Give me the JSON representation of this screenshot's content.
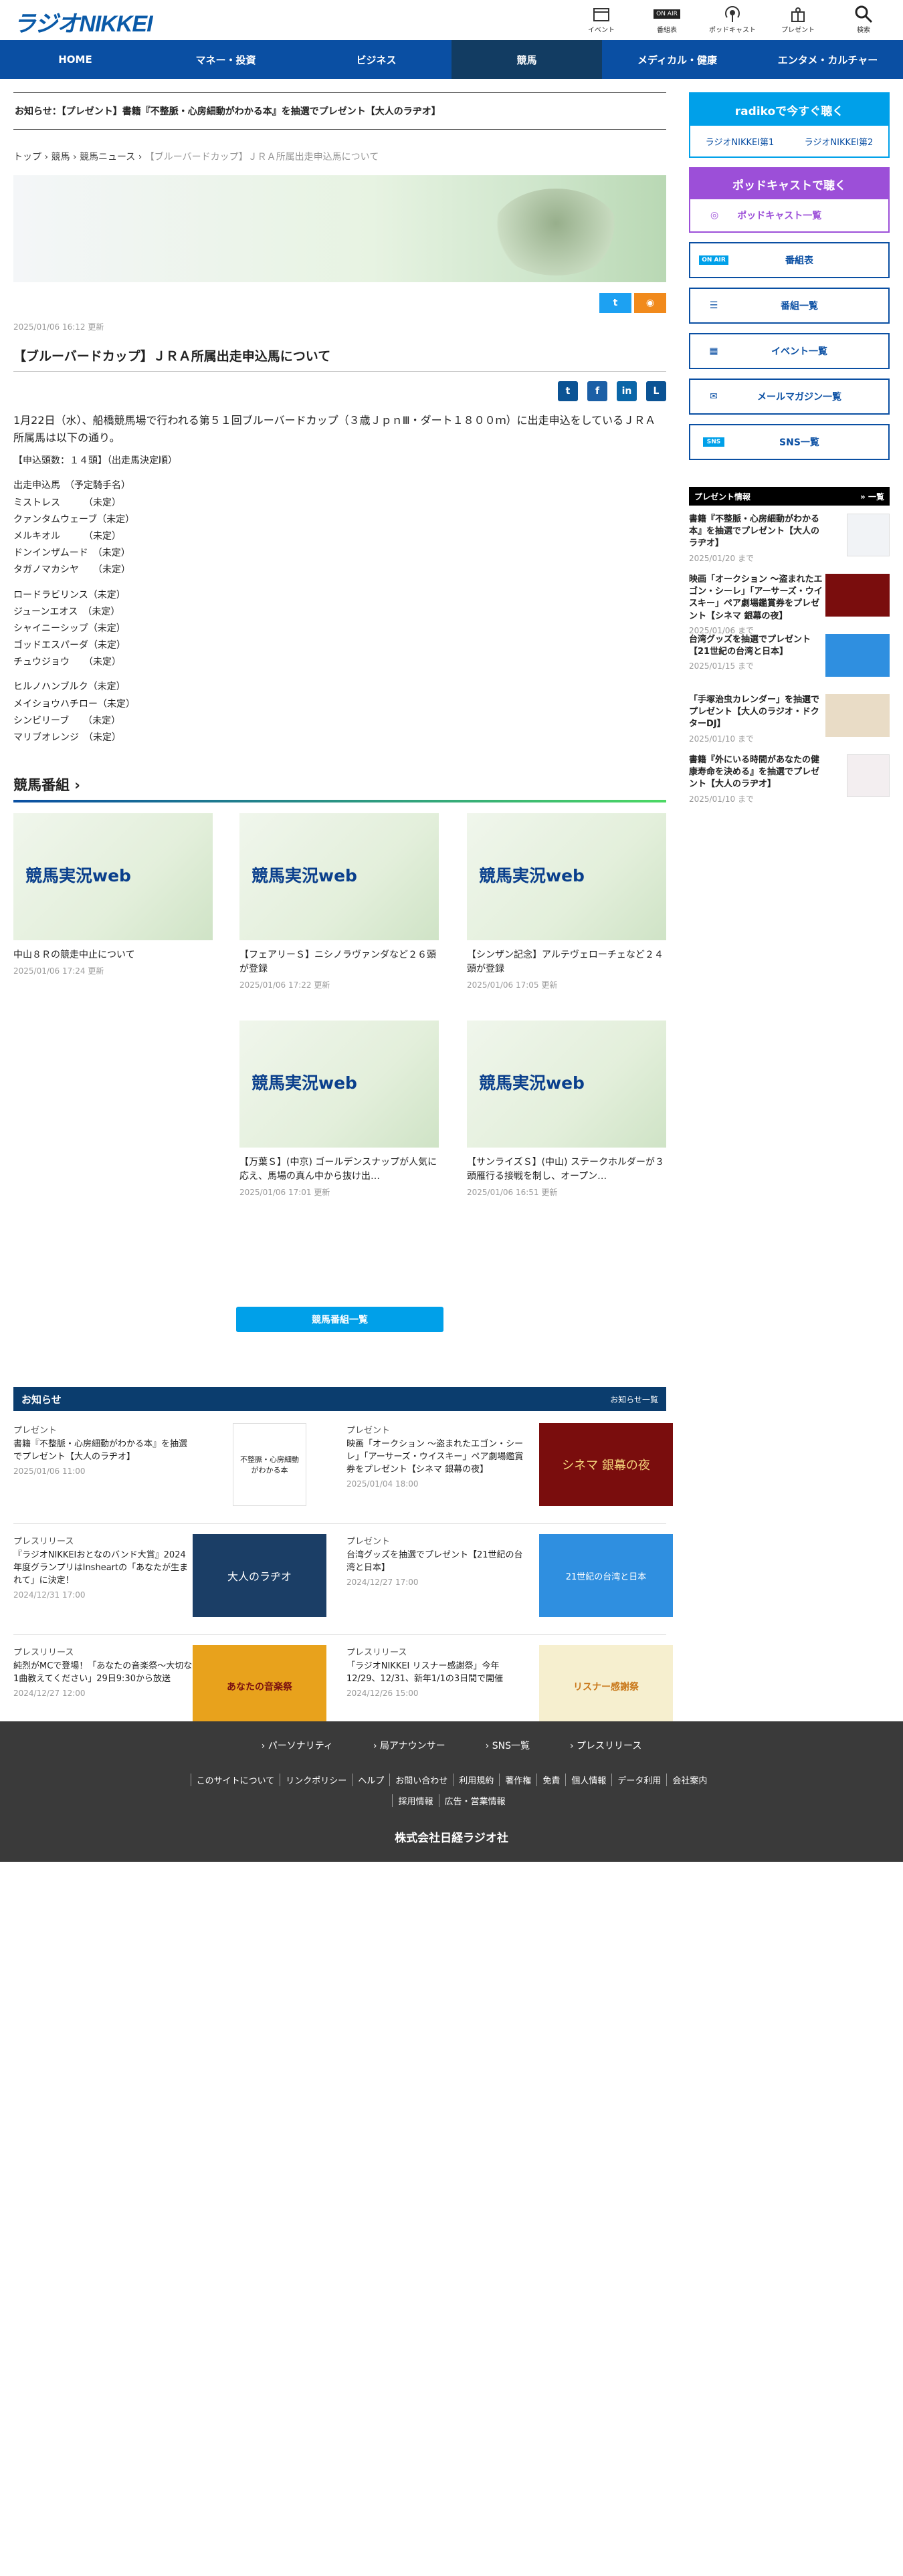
{
  "header": {
    "logo": "ラジオNIKKEI",
    "icons": [
      {
        "name": "calendar-icon",
        "label": "イベント"
      },
      {
        "name": "onair-icon",
        "label": "番組表",
        "badge": "ON AIR"
      },
      {
        "name": "podcast-icon",
        "label": "ポッドキャスト"
      },
      {
        "name": "present-icon",
        "label": "プレゼント"
      },
      {
        "name": "search-icon",
        "label": "検索"
      }
    ]
  },
  "nav": [
    "HOME",
    "マネー・投資",
    "ビジネス",
    "競馬",
    "メディカル・健康",
    "エンタメ・カルチャー"
  ],
  "notice": "お知らせ：【プレゼント】書籍『不整脈・心房細動がわかる本』を抽選でプレゼント【大人のラヂオ】",
  "breadcrumb": {
    "items": [
      "トップ",
      "競馬",
      "競馬ニュース"
    ],
    "current": "【ブルーバードカップ】ＪＲＡ所属出走申込馬について"
  },
  "article": {
    "date": "2025/01/06 16:12 更新",
    "title": "【ブルーバードカップ】ＪＲＡ所属出走申込馬について",
    "lead": "1月22日（水）、船橋競馬場で行われる第５１回ブルーバードカップ（３歳ＪｐｎⅢ・ダート１８００ｍ）に出走申込をしているＪＲＡ所属馬は以下の通り。",
    "count": "【申込頭数：１４頭】（出走馬決定順）",
    "horses1": "出走申込馬　（予定騎手名）\nミストレス　　　（未定）\nクァンタムウェーブ（未定）\nメルキオル　　　（未定）\nドンインザムード　（未定）\nタガノマカシヤ　　（未定）",
    "horses2": "ロードラビリンス（未定）\nジューンエオス　（未定）\nシャイニーシップ（未定）\nゴッドエスパーダ（未定）\nチュウジョウ　　（未定）",
    "horses3": "ヒルノハンブルク（未定）\nメイショウハチロー（未定）\nシンビリーブ　　（未定）\nマリブオレンジ　（未定）"
  },
  "programs": {
    "title": "競馬番組",
    "thumb_text": "競馬実況web",
    "items": [
      {
        "title": "中山８Ｒの競走中止について",
        "date": "2025/01/06 17:24 更新"
      },
      {
        "title": "【フェアリーＳ】ニシノラヴァンダなど２６頭が登録",
        "date": "2025/01/06 17:22 更新"
      },
      {
        "title": "【シンザン記念】アルテヴェローチェなど２４頭が登録",
        "date": "2025/01/06 17:05 更新"
      },
      {
        "title": "【万葉Ｓ】(中京) ゴールデンスナップが人気に応え、馬場の真ん中から抜け出…",
        "date": "2025/01/06 17:01 更新"
      },
      {
        "title": "【サンライズＳ】(中山) ステークホルダーが３頭雁行る接戦を制し、オープン…",
        "date": "2025/01/06 16:51 更新"
      }
    ],
    "button": "競馬番組一覧"
  },
  "news": {
    "title": "お知らせ",
    "more": "お知らせ一覧",
    "items": [
      {
        "cat": "プレゼント",
        "title": "書籍『不整脈・心房細動がわかる本』を抽選でプレゼント【大人のラヂオ】",
        "date": "2025/01/06 11:00",
        "img": "不整脈・心房細動がわかる本"
      },
      {
        "cat": "プレゼント",
        "title": "映画「オークション ～盗まれたエゴン・シーレ」「アーサーズ・ウイスキー」ペア劇場鑑賞券をプレゼント【シネマ 銀幕の夜】",
        "date": "2025/01/04 18:00",
        "img": "シネマ 銀幕の夜"
      },
      {
        "cat": "プレスリリース",
        "title": "『ラジオNIKKEIおとなのバンド大賞』2024年度グランプリはInsheartの「あなたが生まれて」に決定！",
        "date": "2024/12/31 17:00",
        "img": "大人のラヂオ"
      },
      {
        "cat": "プレゼント",
        "title": "台湾グッズを抽選でプレゼント【21世紀の台湾と日本】",
        "date": "2024/12/27 17:00",
        "img": "21世紀の台湾と日本"
      },
      {
        "cat": "プレスリリース",
        "title": "純烈がMCで登場！「あなたの音楽祭～大切な1曲教えてください」29日9:30から放送",
        "date": "2024/12/27 12:00",
        "img": "あなたの音楽祭"
      },
      {
        "cat": "プレスリリース",
        "title": "「ラジオNIKKEI リスナー感謝祭」今年12/29、12/31、新年1/1の3日間で開催",
        "date": "2024/12/26 15:00",
        "img": "リスナー感謝祭"
      }
    ]
  },
  "sidebar": {
    "radiko": "radikoで今すぐ聴く",
    "radiko_links": [
      "ラジオNIKKEI第1",
      "ラジオNIKKEI第2"
    ],
    "podcast": "ポッドキャストで聴く",
    "podcast_link": "ポッドキャスト一覧",
    "buttons": [
      {
        "label": "番組表",
        "icon": "onair-icon"
      },
      {
        "label": "番組一覧",
        "icon": "list-icon"
      },
      {
        "label": "イベント一覧",
        "icon": "calendar-icon"
      },
      {
        "label": "メールマガジン一覧",
        "icon": "mail-icon"
      },
      {
        "label": "SNS一覧",
        "icon": "sns-icon"
      }
    ],
    "present_title": "プレゼント情報",
    "present_more": "一覧",
    "presents": [
      {
        "title": "書籍『不整脈・心房細動がわかる本』を抽選でプレゼント【大人のラヂオ】",
        "date": "2025/01/20 まで"
      },
      {
        "title": "映画「オークション ～盗まれたエゴン・シーレ」「アーサーズ・ウイスキー」ペア劇場鑑賞券をプレゼント【シネマ 銀幕の夜】",
        "date": "2025/01/06 まで"
      },
      {
        "title": "台湾グッズを抽選でプレゼント【21世紀の台湾と日本】",
        "date": "2025/01/15 まで"
      },
      {
        "title": "「手塚治虫カレンダー」を抽選でプレゼント【大人のラジオ・ドクターDJ】",
        "date": "2025/01/10 まで"
      },
      {
        "title": "書籍『外にいる時間があなたの健康寿命を決める』を抽選でプレゼント【大人のラヂオ】",
        "date": "2025/01/10 まで"
      }
    ]
  },
  "footer": {
    "row1": [
      "パーソナリティ",
      "局アナウンサー",
      "SNS一覧",
      "プレスリリース"
    ],
    "row2": [
      "このサイトについて",
      "リンクポリシー",
      "ヘルプ",
      "お問い合わせ",
      "利用規約",
      "著作権",
      "免責",
      "個人情報",
      "データ利用",
      "会社案内",
      "採用情報",
      "広告・営業情報"
    ],
    "company": "株式会社日経ラジオ社"
  }
}
